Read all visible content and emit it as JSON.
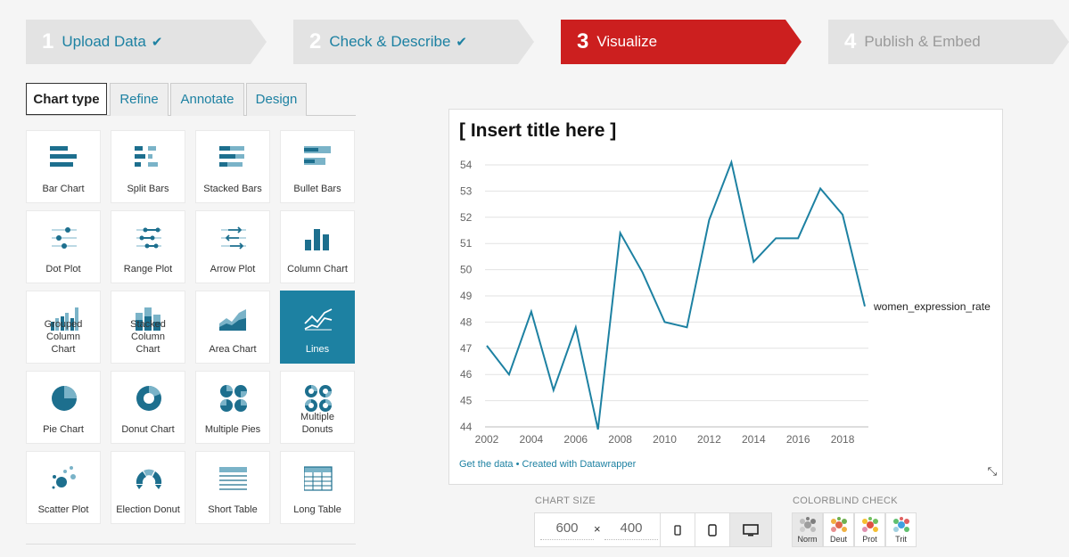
{
  "steps": [
    {
      "num": "1",
      "label": "Upload Data",
      "check": "✔"
    },
    {
      "num": "2",
      "label": "Check & Describe",
      "check": "✔"
    },
    {
      "num": "3",
      "label": "Visualize"
    },
    {
      "num": "4",
      "label": "Publish & Embed"
    }
  ],
  "colors": {
    "accent": "#1d81a2",
    "active_step": "#cc1f1f",
    "step_bg": "#e3e3e3"
  },
  "tabs": [
    "Chart type",
    "Refine",
    "Annotate",
    "Design"
  ],
  "chart_types": [
    {
      "label": "Bar Chart",
      "icon": "bar-chart-icon"
    },
    {
      "label": "Split Bars",
      "icon": "split-bars-icon"
    },
    {
      "label": "Stacked Bars",
      "icon": "stacked-bars-icon"
    },
    {
      "label": "Bullet Bars",
      "icon": "bullet-bars-icon"
    },
    {
      "label": "Dot Plot",
      "icon": "dot-plot-icon"
    },
    {
      "label": "Range Plot",
      "icon": "range-plot-icon"
    },
    {
      "label": "Arrow Plot",
      "icon": "arrow-plot-icon"
    },
    {
      "label": "Column Chart",
      "icon": "column-chart-icon"
    },
    {
      "label": "Grouped Column Chart",
      "icon": "grouped-column-icon"
    },
    {
      "label": "Stacked Column Chart",
      "icon": "stacked-column-icon"
    },
    {
      "label": "Area Chart",
      "icon": "area-chart-icon"
    },
    {
      "label": "Lines",
      "icon": "lines-icon",
      "selected": true
    },
    {
      "label": "Pie Chart",
      "icon": "pie-chart-icon"
    },
    {
      "label": "Donut Chart",
      "icon": "donut-chart-icon"
    },
    {
      "label": "Multiple Pies",
      "icon": "multiple-pies-icon"
    },
    {
      "label": "Multiple Donuts",
      "icon": "multiple-donuts-icon"
    },
    {
      "label": "Scatter Plot",
      "icon": "scatter-plot-icon"
    },
    {
      "label": "Election Donut",
      "icon": "election-donut-icon"
    },
    {
      "label": "Short Table",
      "icon": "short-table-icon"
    },
    {
      "label": "Long Table",
      "icon": "long-table-icon"
    }
  ],
  "preview": {
    "title": "[ Insert title here ]",
    "footer": "Get the data • Created with Datawrapper",
    "resize_glyph": "⤡"
  },
  "chart_data": {
    "type": "line",
    "title": "[ Insert title here ]",
    "x": [
      2002,
      2003,
      2004,
      2005,
      2006,
      2007,
      2008,
      2009,
      2010,
      2011,
      2012,
      2013,
      2014,
      2015,
      2016,
      2017,
      2018,
      2019
    ],
    "series": [
      {
        "name": "women_expression_rate",
        "values": [
          47.1,
          46.0,
          48.4,
          45.4,
          47.8,
          43.9,
          51.4,
          49.9,
          48.0,
          47.8,
          51.9,
          54.1,
          50.3,
          51.2,
          51.2,
          53.1,
          52.1,
          48.6
        ]
      }
    ],
    "xticks": [
      "2002",
      "2004",
      "2006",
      "2008",
      "2010",
      "2012",
      "2014",
      "2016",
      "2018"
    ],
    "yticks": [
      "44",
      "45",
      "46",
      "47",
      "48",
      "49",
      "50",
      "51",
      "52",
      "53",
      "54"
    ],
    "xlim": [
      2002,
      2019
    ],
    "ylim": [
      44,
      54
    ],
    "grid": "horizontal",
    "line_color": "#1d81a2"
  },
  "chart_size": {
    "label": "CHART SIZE",
    "width": "600",
    "height": "400",
    "times": "×"
  },
  "colorblind": {
    "label": "COLORBLIND CHECK",
    "modes": [
      "Norm",
      "Deut",
      "Prot",
      "Trit"
    ]
  }
}
